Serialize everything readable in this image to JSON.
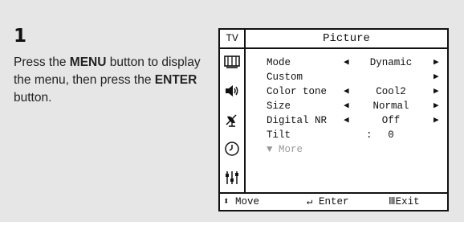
{
  "step": {
    "number": "1"
  },
  "instructions": {
    "t1": "Press the ",
    "b1": "MENU",
    "t2": " button to display the menu, then press the ",
    "b2": "ENTER",
    "t3": " button."
  },
  "osd": {
    "source": "TV",
    "title": "Picture",
    "sidebar_icons": [
      "picture-icon",
      "sound-icon",
      "channel-antenna-icon",
      "clock-icon",
      "setup-icon"
    ],
    "rows": [
      {
        "label": "Mode",
        "value": "Dynamic",
        "left_arrow": "◀",
        "right_arrow": "▶"
      },
      {
        "label": "Custom",
        "value": "",
        "left_arrow": "",
        "right_arrow": "▶"
      },
      {
        "label": "Color tone",
        "value": "Cool2",
        "left_arrow": "◀",
        "right_arrow": "▶"
      },
      {
        "label": "Size",
        "value": "Normal",
        "left_arrow": "◀",
        "right_arrow": "▶"
      },
      {
        "label": "Digital NR",
        "value": "Off",
        "left_arrow": "◀",
        "right_arrow": "▶"
      },
      {
        "label": "Tilt",
        "separator": ":",
        "value": "0"
      },
      {
        "label": "▼ More"
      }
    ],
    "footer": {
      "move_icon": "⬍",
      "move": "Move",
      "enter_icon": "↵",
      "enter": "Enter",
      "exit_icon": "Ⅲ",
      "exit": "Exit"
    }
  }
}
